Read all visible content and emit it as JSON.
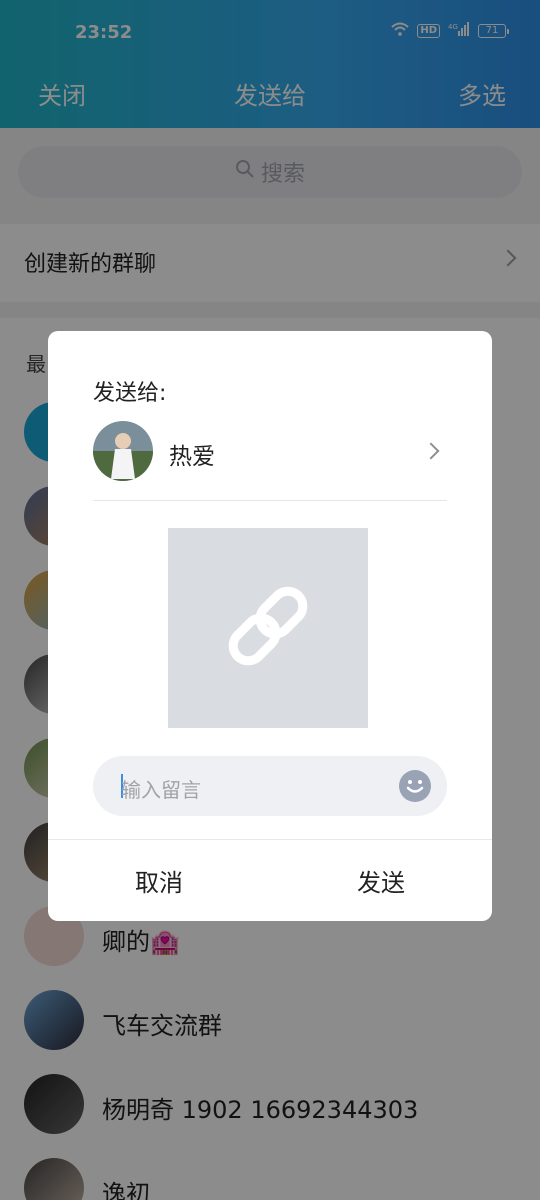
{
  "status_bar": {
    "time": "23:52",
    "hd_badge": "HD",
    "network": "4G",
    "battery": "71"
  },
  "header": {
    "left_action": "关闭",
    "title": "发送给",
    "right_action": "多选",
    "gradient_colors": [
      "#1fb6c6",
      "#36a9ef",
      "#2e8fe6"
    ]
  },
  "search": {
    "placeholder": "搜索"
  },
  "create_group": {
    "label": "创建新的群聊"
  },
  "recent": {
    "title": "最",
    "contacts": [
      {
        "name": ""
      },
      {
        "name": ""
      },
      {
        "name": ""
      },
      {
        "name": ""
      },
      {
        "name": ""
      },
      {
        "name": ""
      },
      {
        "name": "卿的🏩"
      },
      {
        "name": "飞车交流群"
      },
      {
        "name": "杨明奇 1902   16692344303"
      },
      {
        "name": "逸初"
      }
    ]
  },
  "dialog": {
    "send_to_label": "发送给:",
    "recipient_name": "热爱",
    "message_placeholder": "输入留言",
    "cancel_label": "取消",
    "send_label": "发送",
    "preview_icon": "link-icon",
    "emoji_icon": "emoji-icon"
  }
}
